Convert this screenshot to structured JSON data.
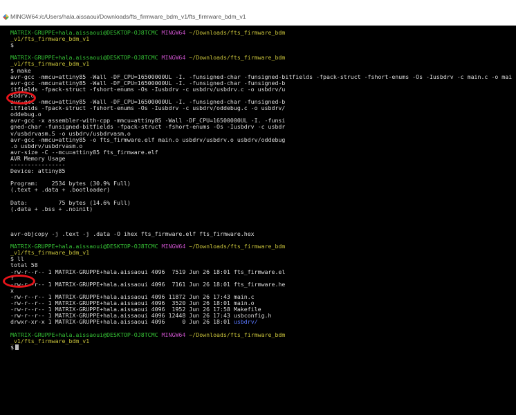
{
  "window": {
    "title": "MINGW64:/c/Users/hala.aissaoui/Downloads/fts_firmware_bdm_v1/fts_firmware_bdm_v1"
  },
  "colors": {
    "background": "#000000",
    "text": "#dcdcdc",
    "prompt_user": "#35c235",
    "prompt_env": "#c34fc3",
    "prompt_path": "#c8c23a",
    "directory": "#5a78ff",
    "annotation": "#e8141a"
  },
  "terminal": {
    "lines": [
      {
        "kind": "prompt",
        "user": "MATRIX-GRUPPE+hala.aissaoui@DESKTOP-OJ8TCMC",
        "env": "MINGW64",
        "path": "~/Downloads/fts_firmware_bdm"
      },
      {
        "kind": "path",
        "text": "_v1/fts_firmware_bdm_v1"
      },
      {
        "kind": "cmd",
        "text": "$"
      },
      {
        "kind": "blank"
      },
      {
        "kind": "prompt",
        "user": "MATRIX-GRUPPE+hala.aissaoui@DESKTOP-OJ8TCMC",
        "env": "MINGW64",
        "path": "~/Downloads/fts_firmware_bdm"
      },
      {
        "kind": "path",
        "text": "_v1/fts_firmware_bdm_v1"
      },
      {
        "kind": "cmd",
        "text": "$ make"
      },
      {
        "kind": "out",
        "text": "avr-gcc -mmcu=attiny85 -Wall -DF_CPU=16500000UL -I. -funsigned-char -funsigned-bitfields -fpack-struct -fshort-enums -Os -Iusbdrv -c main.c -o main.o"
      },
      {
        "kind": "out",
        "text": "avr-gcc -mmcu=attiny85 -Wall -DF_CPU=16500000UL -I. -funsigned-char -funsigned-b"
      },
      {
        "kind": "out",
        "text": "itfields -fpack-struct -fshort-enums -Os -Iusbdrv -c usbdrv/usbdrv.c -o usbdrv/u"
      },
      {
        "kind": "out",
        "text": "sbdrv.o"
      },
      {
        "kind": "out",
        "text": "avr-gcc -mmcu=attiny85 -Wall -DF_CPU=16500000UL -I. -funsigned-char -funsigned-b"
      },
      {
        "kind": "out",
        "text": "itfields -fpack-struct -fshort-enums -Os -Iusbdrv -c usbdrv/oddebug.c -o usbdrv/"
      },
      {
        "kind": "out",
        "text": "oddebug.o"
      },
      {
        "kind": "out",
        "text": "avr-gcc -x assembler-with-cpp -mmcu=attiny85 -Wall -DF_CPU=16500000UL -I. -funsi"
      },
      {
        "kind": "out",
        "text": "gned-char -funsigned-bitfields -fpack-struct -fshort-enums -Os -Iusbdrv -c usbdr"
      },
      {
        "kind": "out",
        "text": "v/usbdrvasm.S -o usbdrv/usbdrvasm.o"
      },
      {
        "kind": "out",
        "text": "avr-gcc -mmcu=attiny85 -o fts_firmware.elf main.o usbdrv/usbdrv.o usbdrv/oddebug"
      },
      {
        "kind": "out",
        "text": ".o usbdrv/usbdrvasm.o"
      },
      {
        "kind": "out",
        "text": "avr-size -C --mcu=attiny85 fts_firmware.elf"
      },
      {
        "kind": "out",
        "text": "AVR Memory Usage"
      },
      {
        "kind": "out",
        "text": "----------------"
      },
      {
        "kind": "out",
        "text": "Device: attiny85"
      },
      {
        "kind": "blank"
      },
      {
        "kind": "out",
        "text": "Program:    2534 bytes (30.9% Full)"
      },
      {
        "kind": "out",
        "text": "(.text + .data + .bootloader)"
      },
      {
        "kind": "blank"
      },
      {
        "kind": "out",
        "text": "Data:         75 bytes (14.6% Full)"
      },
      {
        "kind": "out",
        "text": "(.data + .bss + .noinit)"
      },
      {
        "kind": "blank"
      },
      {
        "kind": "blank"
      },
      {
        "kind": "blank"
      },
      {
        "kind": "out",
        "text": "avr-objcopy -j .text -j .data -O ihex fts_firmware.elf fts_firmware.hex"
      },
      {
        "kind": "blank"
      },
      {
        "kind": "prompt",
        "user": "MATRIX-GRUPPE+hala.aissaoui@DESKTOP-OJ8TCMC",
        "env": "MINGW64",
        "path": "~/Downloads/fts_firmware_bdm"
      },
      {
        "kind": "path",
        "text": "_v1/fts_firmware_bdm_v1"
      },
      {
        "kind": "cmd",
        "text": "$ ll"
      },
      {
        "kind": "out",
        "text": "total 58"
      },
      {
        "kind": "out",
        "text": "-rw-r--r-- 1 MATRIX-GRUPPE+hala.aissaoui 4096  7519 Jun 26 18:01 fts_firmware.el"
      },
      {
        "kind": "out",
        "text": "f"
      },
      {
        "kind": "out",
        "text": "-rw-r--r-- 1 MATRIX-GRUPPE+hala.aissaoui 4096  7161 Jun 26 18:01 fts_firmware.he"
      },
      {
        "kind": "out",
        "text": "x"
      },
      {
        "kind": "out",
        "text": "-rw-r--r-- 1 MATRIX-GRUPPE+hala.aissaoui 4096 11872 Jun 26 17:43 main.c"
      },
      {
        "kind": "out",
        "text": "-rw-r--r-- 1 MATRIX-GRUPPE+hala.aissaoui 4096  3520 Jun 26 18:01 main.o"
      },
      {
        "kind": "out",
        "text": "-rw-r--r-- 1 MATRIX-GRUPPE+hala.aissaoui 4096  1952 Jun 26 17:58 Makefile"
      },
      {
        "kind": "out",
        "text": "-rw-r--r-- 1 MATRIX-GRUPPE+hala.aissaoui 4096 12448 Jun 26 17:43 usbconfig.h"
      },
      {
        "kind": "dir",
        "text": "drwxr-xr-x 1 MATRIX-GRUPPE+hala.aissaoui 4096     0 Jun 26 18:01 ",
        "dirname": "usbdrv/"
      },
      {
        "kind": "blank"
      },
      {
        "kind": "prompt",
        "user": "MATRIX-GRUPPE+hala.aissaoui@DESKTOP-OJ8TCMC",
        "env": "MINGW64",
        "path": "~/Downloads/fts_firmware_bdm"
      },
      {
        "kind": "path",
        "text": "_v1/fts_firmware_bdm_v1"
      },
      {
        "kind": "cursor",
        "text": "$"
      }
    ]
  }
}
